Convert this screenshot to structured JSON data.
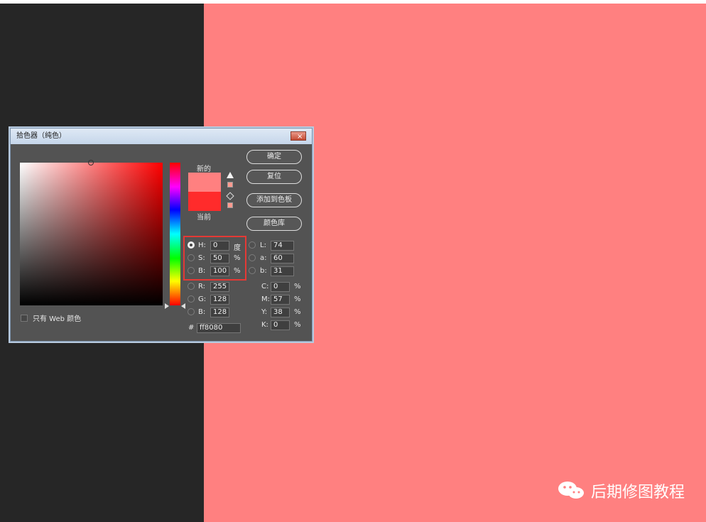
{
  "dialog": {
    "title": "拾色器（纯色）",
    "close_icon": "close-icon",
    "buttons": {
      "ok": "确定",
      "reset": "复位",
      "add_swatch": "添加到色板",
      "color_library": "颜色库"
    },
    "preview": {
      "new_label": "新的",
      "current_label": "当前",
      "new_color": "#ff8080",
      "current_color": "#ff2b2b"
    },
    "web_only": "只有 Web 颜色",
    "fields": {
      "h": {
        "label": "H:",
        "value": "0",
        "unit": "度"
      },
      "s": {
        "label": "S:",
        "value": "50",
        "unit": "%"
      },
      "b": {
        "label": "B:",
        "value": "100",
        "unit": "%"
      },
      "r": {
        "label": "R:",
        "value": "255"
      },
      "g": {
        "label": "G:",
        "value": "128"
      },
      "b2": {
        "label": "B:",
        "value": "128"
      },
      "l": {
        "label": "L:",
        "value": "74"
      },
      "a": {
        "label": "a:",
        "value": "60"
      },
      "b3": {
        "label": "b:",
        "value": "31"
      },
      "c": {
        "label": "C:",
        "value": "0",
        "unit": "%"
      },
      "m": {
        "label": "M:",
        "value": "57",
        "unit": "%"
      },
      "y": {
        "label": "Y:",
        "value": "38",
        "unit": "%"
      },
      "k": {
        "label": "K:",
        "value": "0",
        "unit": "%"
      },
      "hex": {
        "label": "#",
        "value": "ff8080"
      }
    }
  },
  "watermark": {
    "text": "后期修图教程",
    "icon": "wechat-icon"
  },
  "colors": {
    "canvas": "#ff8080",
    "left_panel": "#262626",
    "dialog_bg": "#535353",
    "highlight": "#e53935"
  }
}
